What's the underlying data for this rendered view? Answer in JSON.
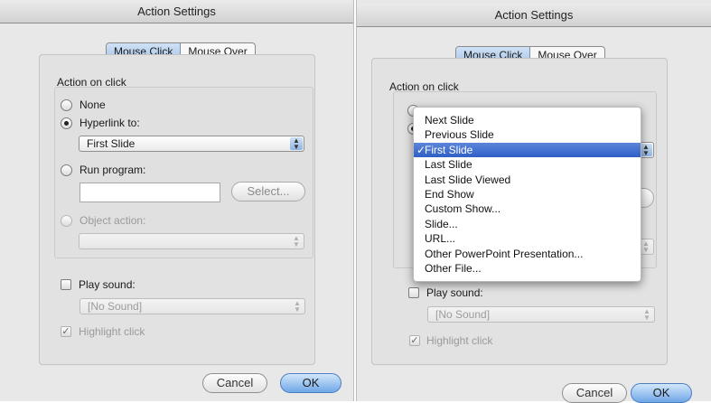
{
  "left": {
    "title": "Action Settings",
    "tabs": [
      "Mouse Click",
      "Mouse Over"
    ],
    "section_title": "Action on click",
    "radio_none": "None",
    "radio_hyperlink": "Hyperlink to:",
    "hyperlink_value": "First Slide",
    "radio_run_program": "Run program:",
    "select_button": "Select...",
    "radio_object_action": "Object action:",
    "play_sound": "Play sound:",
    "sound_value": "[No Sound]",
    "highlight_click": "Highlight click",
    "cancel": "Cancel",
    "ok": "OK"
  },
  "right": {
    "title": "Action Settings",
    "tabs": [
      "Mouse Click",
      "Mouse Over"
    ],
    "section_title": "Action on click",
    "play_sound": "Play sound:",
    "sound_value": "[No Sound]",
    "highlight_click": "Highlight click",
    "cancel": "Cancel",
    "ok": "OK",
    "menu_items": [
      "Next Slide",
      "Previous Slide",
      "First Slide",
      "Last Slide",
      "Last Slide Viewed",
      "End Show",
      "Custom Show...",
      "Slide...",
      "URL...",
      "Other PowerPoint Presentation...",
      "Other File..."
    ],
    "selected_index": 2,
    "check_glyph": "✓"
  },
  "icons": {
    "popup_arrows": "up-down-arrows-icon",
    "checkmark": "checkmark-icon"
  }
}
